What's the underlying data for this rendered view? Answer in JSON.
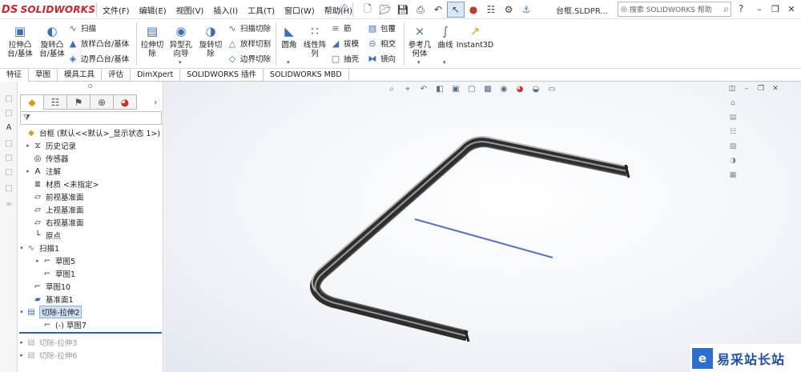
{
  "app": {
    "logo_text": "SOLIDWORKS",
    "logo_mark": "DS",
    "doc_title": "台框.SLDPR...",
    "search_placeholder": "搜索 SOLIDWORKS 帮助",
    "help_label": "?",
    "brand_color": "#d2232a",
    "accent_color": "#2a63b8"
  },
  "menus": [
    "文件(F)",
    "编辑(E)",
    "视图(V)",
    "插入(I)",
    "工具(T)",
    "窗口(W)",
    "帮助(H)"
  ],
  "ribbon": {
    "extrude_boss": "拉伸凸\n台/基体",
    "revolve_boss": "旋转凸\n台/基体",
    "sweep": "扫描",
    "loft": "放样凸台/基体",
    "boundary_boss": "边界凸台/基体",
    "extrude_cut": "拉伸切\n除",
    "hole_wizard": "异型孔\n向导",
    "revolve_cut": "旋转切\n除",
    "swept_cut": "扫描切除",
    "lofted_cut": "放样切割",
    "boundary_cut": "边界切除",
    "fillet": "圆角",
    "linear_pattern": "线性阵\n列",
    "rib": "筋",
    "draft": "拔模",
    "shell": "抽壳",
    "wrap": "包覆",
    "intersect": "相交",
    "mirror": "镜向",
    "ref_geometry": "参考几\n何体",
    "curves": "曲线",
    "instant3d": "Instant3D"
  },
  "tabs": [
    "特征",
    "草图",
    "模具工具",
    "评估",
    "DimXpert",
    "SOLIDWORKS 插件",
    "SOLIDWORKS MBD"
  ],
  "tree": {
    "root": "台框 (默认<<默认>_显示状态 1>)",
    "items": [
      {
        "label": "历史记录"
      },
      {
        "label": "传感器"
      },
      {
        "label": "注解"
      },
      {
        "label": "材质 <未指定>"
      },
      {
        "label": "前视基准面"
      },
      {
        "label": "上视基准面"
      },
      {
        "label": "右视基准面"
      },
      {
        "label": "原点"
      },
      {
        "label": "扫描1"
      },
      {
        "label": "草图5"
      },
      {
        "label": "草图1"
      },
      {
        "label": "草图10"
      },
      {
        "label": "基准面1"
      },
      {
        "label": "切除-拉伸2"
      },
      {
        "label": "(-) 草图7"
      },
      {
        "label": "切除-拉伸3"
      },
      {
        "label": "切除-拉伸6"
      }
    ]
  },
  "watermark": {
    "mark": "e",
    "text": "易采站长站"
  }
}
